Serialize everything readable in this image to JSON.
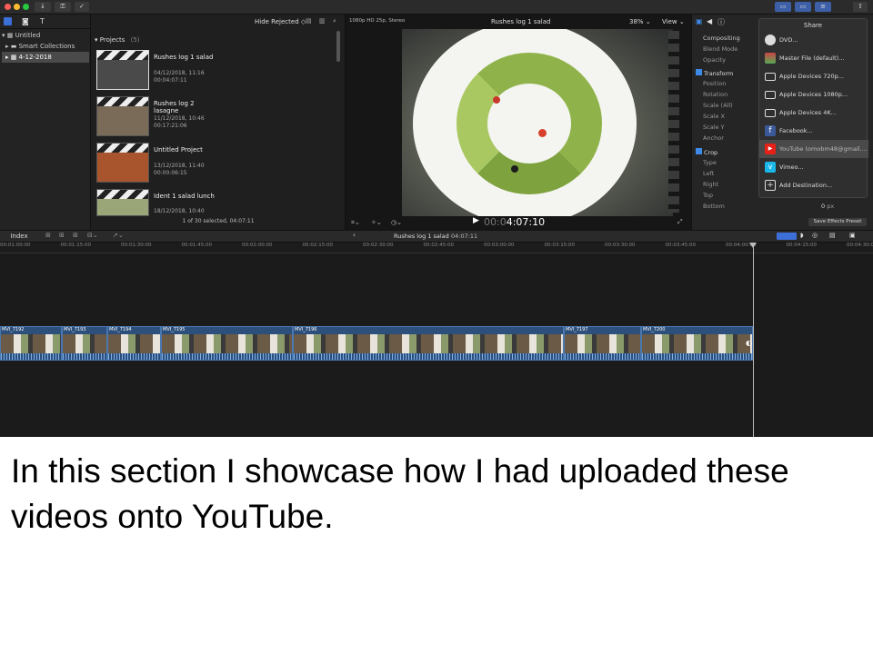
{
  "toolbar": {
    "hide_rejected": "Hide Rejected"
  },
  "library": {
    "items": [
      {
        "label": "Untitled"
      },
      {
        "label": "Smart Collections"
      },
      {
        "label": "4-12-2018"
      }
    ]
  },
  "browser": {
    "header": "Projects",
    "count": "(5)",
    "projects": [
      {
        "title": "Rushes log 1 salad",
        "date": "04/12/2018, 11:16",
        "duration": "00:04:07:11"
      },
      {
        "title": "Rushes log 2 lasagne",
        "date": "11/12/2018, 10:46",
        "duration": "00:17:21:06"
      },
      {
        "title": "Untitled Project",
        "date": "13/12/2018, 11:40",
        "duration": "00:00:06:15"
      },
      {
        "title": "Ident 1 salad lunch",
        "date": "18/12/2018, 10:40",
        "duration": ""
      }
    ],
    "footer": "1 of 30 selected, 04:07:11"
  },
  "viewer": {
    "format": "1080p HD 25p, Stereo",
    "project": "Rushes log 1 salad",
    "zoom": "38%",
    "view": "View",
    "timecode": "4:07:10"
  },
  "inspector": {
    "rows": [
      {
        "label": "Compositing"
      },
      {
        "label": "Blend Mode"
      },
      {
        "label": "Opacity"
      },
      {
        "label": "Transform"
      },
      {
        "label": "Position"
      },
      {
        "label": "Rotation"
      },
      {
        "label": "Scale (All)"
      },
      {
        "label": "Scale X"
      },
      {
        "label": "Scale Y"
      },
      {
        "label": "Anchor"
      },
      {
        "label": "Crop"
      },
      {
        "label": "Type"
      },
      {
        "label": "Left"
      },
      {
        "label": "Right"
      },
      {
        "label": "Top"
      },
      {
        "label": "Bottom"
      }
    ],
    "bottom_value": "0",
    "bottom_unit": "px",
    "save_preset": "Save Effects Preset"
  },
  "share": {
    "title": "Share",
    "items": [
      {
        "label": "DVD...",
        "icon": "dvd-icon",
        "color": "#dddddd"
      },
      {
        "label": "Master File (default)...",
        "icon": "master-file-icon",
        "color": "#cc4444"
      },
      {
        "label": "Apple Devices 720p...",
        "icon": "apple-devices-icon",
        "color": "#dddddd"
      },
      {
        "label": "Apple Devices 1080p...",
        "icon": "apple-devices-icon",
        "color": "#dddddd"
      },
      {
        "label": "Apple Devices 4K...",
        "icon": "apple-devices-icon",
        "color": "#dddddd"
      },
      {
        "label": "Facebook...",
        "icon": "facebook-icon",
        "color": "#3b5998"
      },
      {
        "label": "YouTube (omobm48@gmail....",
        "icon": "youtube-icon",
        "color": "#e62117"
      },
      {
        "label": "Vimeo...",
        "icon": "vimeo-icon",
        "color": "#1ab7ea"
      },
      {
        "label": "Add Destination...",
        "icon": "add-destination-icon",
        "color": "#dddddd"
      }
    ]
  },
  "timeline": {
    "index": "Index",
    "project": "Rushes log 1 salad",
    "duration": "04:07:11",
    "ruler": [
      "00:01:00:00",
      "00:01:15:00",
      "00:01:30:00",
      "00:01:45:00",
      "00:02:00:00",
      "00:02:15:00",
      "00:02:30:00",
      "00:02:45:00",
      "00:03:00:00",
      "00:03:15:00",
      "00:03:30:00",
      "00:03:45:00",
      "00:04:00:00",
      "00:04:15:00",
      "00:04:30:00"
    ],
    "clips": [
      "MVI_7192",
      "MVI_7193",
      "MVI_7194",
      "MVI_7195",
      "MVI_7196",
      "MVI_7197",
      "MVI_7200"
    ]
  },
  "caption": "In this section I showcase how I had uploaded these videos onto YouTube."
}
